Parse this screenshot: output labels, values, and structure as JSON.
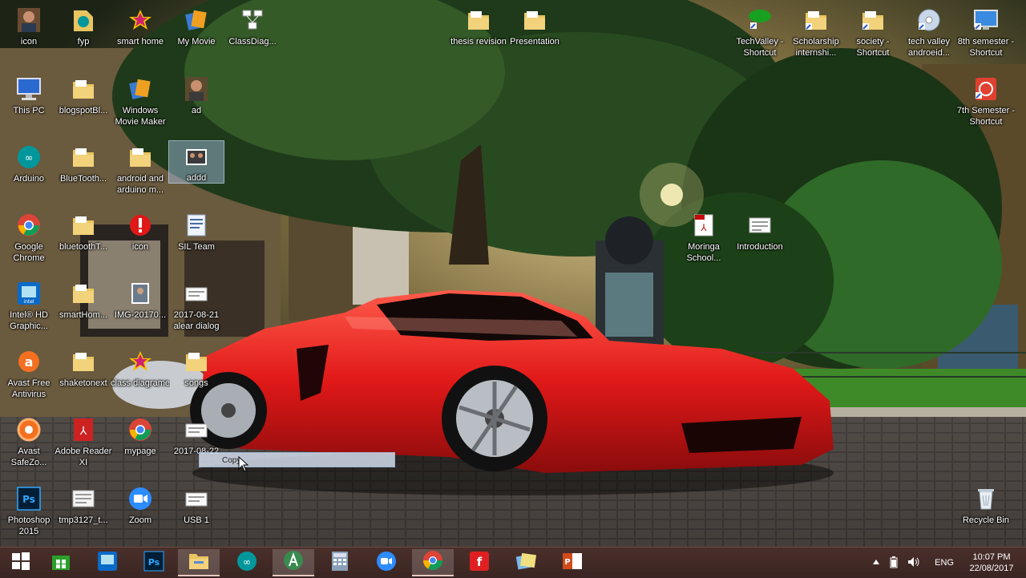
{
  "desktop": {
    "icons": [
      {
        "name": "icon",
        "type": "user-photo-icon"
      },
      {
        "name": "fyp",
        "type": "arduino-file-icon"
      },
      {
        "name": "smart home",
        "type": "movie-project-icon"
      },
      {
        "name": "My Movie",
        "type": "movie-maker-icon"
      },
      {
        "name": "ClassDiag...",
        "type": "diagram-icon"
      },
      {
        "name": "thesis revision",
        "type": "folder-icon"
      },
      {
        "name": "Presentation",
        "type": "folder-icon"
      },
      {
        "name": "TechValley - Shortcut",
        "type": "web-shortcut-icon"
      },
      {
        "name": "Scholarship internshi...",
        "type": "folder-shortcut-icon"
      },
      {
        "name": "society - Shortcut",
        "type": "folder-shortcut-icon"
      },
      {
        "name": "tech valley androeid...",
        "type": "disc-icon"
      },
      {
        "name": "8th semester - Shortcut",
        "type": "monitor-shortcut-icon"
      },
      {
        "name": "This PC",
        "type": "computer-icon"
      },
      {
        "name": "blogspotBl...",
        "type": "folder-icon"
      },
      {
        "name": "Windows Movie Maker",
        "type": "movie-maker-icon"
      },
      {
        "name": "ad",
        "type": "user-photo-icon"
      },
      {
        "name": "7th Semester - Shortcut",
        "type": "pdf-shortcut-icon"
      },
      {
        "name": "Arduino",
        "type": "arduino-icon"
      },
      {
        "name": "BlueTooth...",
        "type": "folder-icon"
      },
      {
        "name": "android and arduino m...",
        "type": "folder-icon"
      },
      {
        "name": "addd",
        "type": "photo-icon"
      },
      {
        "name": "Google Chrome",
        "type": "chrome-icon"
      },
      {
        "name": "bluetoothT...",
        "type": "folder-icon"
      },
      {
        "name": "icon",
        "type": "warning-icon"
      },
      {
        "name": "SIL Team",
        "type": "document-icon"
      },
      {
        "name": "Moringa School...",
        "type": "pdf-icon"
      },
      {
        "name": "Introduction",
        "type": "document-icon"
      },
      {
        "name": "Intel® HD Graphic...",
        "type": "intel-graphics-icon"
      },
      {
        "name": "smartHom...",
        "type": "folder-icon"
      },
      {
        "name": "IMG-20170...",
        "type": "photo-icon"
      },
      {
        "name": "2017-08-21 alear dialog",
        "type": "file-icon"
      },
      {
        "name": "Avast Free Antivirus",
        "type": "avast-icon"
      },
      {
        "name": "shaketonext",
        "type": "folder-icon"
      },
      {
        "name": "class diagrame",
        "type": "movie-project-icon"
      },
      {
        "name": "songs",
        "type": "folder-icon"
      },
      {
        "name": "Avast SafeZo...",
        "type": "avast-safezone-icon"
      },
      {
        "name": "Adobe Reader XI",
        "type": "adobe-reader-icon"
      },
      {
        "name": "mypage",
        "type": "chrome-icon"
      },
      {
        "name": "2017-08-22",
        "type": "file-icon"
      },
      {
        "name": "Photoshop 2015",
        "type": "photoshop-icon"
      },
      {
        "name": "tmp3127_t...",
        "type": "file-icon"
      },
      {
        "name": "Zoom",
        "type": "zoom-icon"
      },
      {
        "name": "USB 1",
        "type": "file-icon"
      },
      {
        "name": "Recycle Bin",
        "type": "recycle-bin-icon"
      }
    ],
    "rename_text": "Copy"
  },
  "taskbar": {
    "items": [
      {
        "label": "Start",
        "icon": "windows-start-icon"
      },
      {
        "label": "Store",
        "icon": "store-icon"
      },
      {
        "label": "Intel HD Graphics",
        "icon": "intel-graphics-icon"
      },
      {
        "label": "Photoshop",
        "icon": "photoshop-icon"
      },
      {
        "label": "File Explorer",
        "icon": "file-explorer-icon"
      },
      {
        "label": "Arduino",
        "icon": "arduino-icon"
      },
      {
        "label": "Android Studio",
        "icon": "android-studio-icon"
      },
      {
        "label": "Calculator",
        "icon": "calculator-icon"
      },
      {
        "label": "Zoom",
        "icon": "zoom-icon"
      },
      {
        "label": "Google Chrome",
        "icon": "chrome-icon"
      },
      {
        "label": "Foxit",
        "icon": "foxit-icon"
      },
      {
        "label": "Sticky Notes",
        "icon": "notes-icon"
      },
      {
        "label": "PowerPoint",
        "icon": "powerpoint-icon"
      }
    ],
    "tray": {
      "language": "ENG",
      "time": "10:07 PM",
      "date": "22/08/2017"
    }
  },
  "colors": {
    "folder": "#e8c560",
    "taskbar": "#3a2522",
    "car_red": "#d9191c"
  }
}
